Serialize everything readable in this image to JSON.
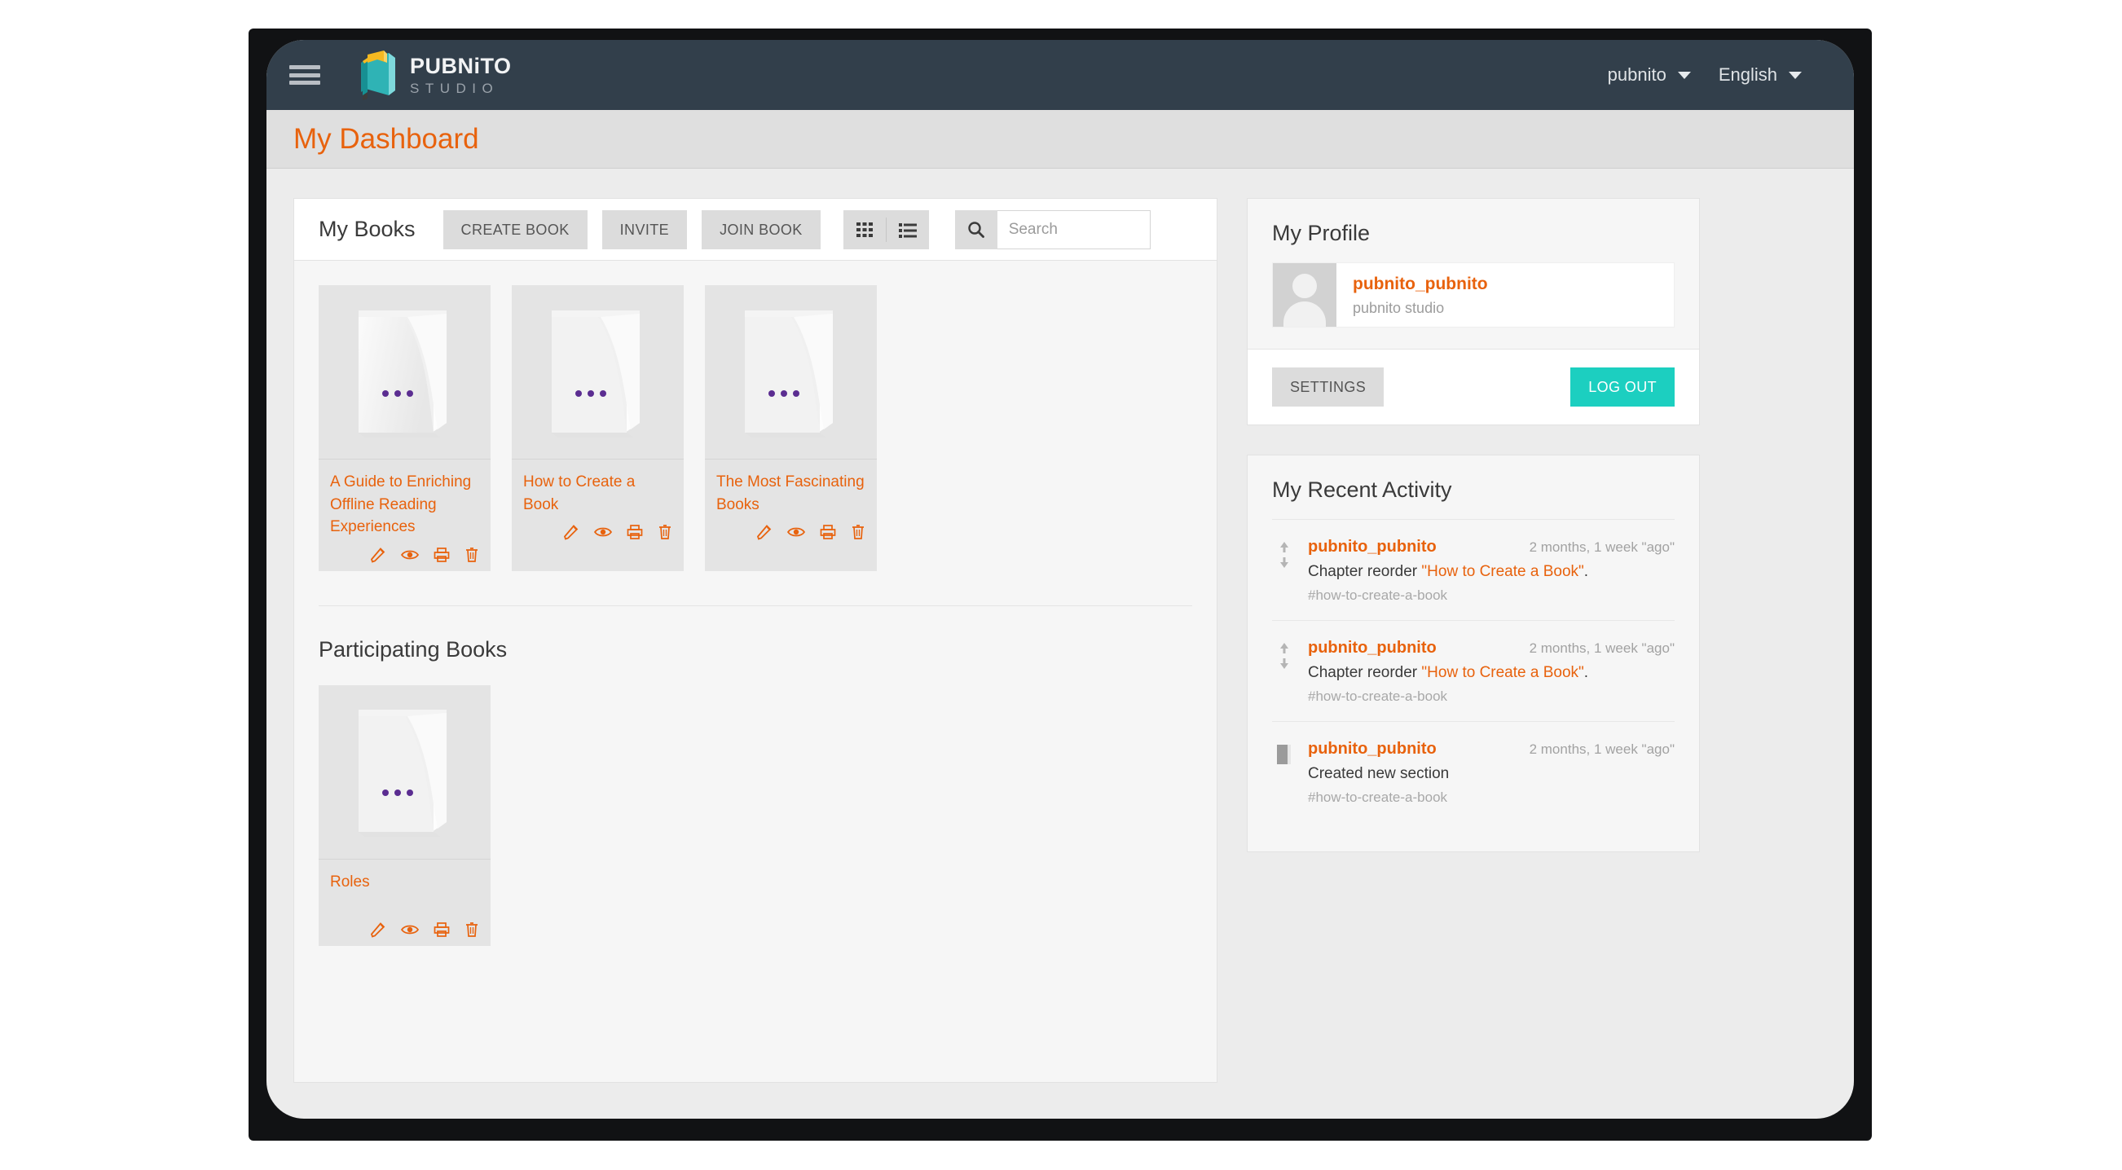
{
  "navbar": {
    "menu_icon": "hamburger-icon",
    "logo_title": "PUBNiTO",
    "logo_subtitle": "STUDIO",
    "user_menu": "pubnito",
    "language_menu": "English"
  },
  "page": {
    "title": "My Dashboard"
  },
  "books": {
    "heading": "My Books",
    "create_label": "CREATE BOOK",
    "invite_label": "INVITE",
    "join_label": "JOIN BOOK",
    "grid_view_icon": "grid-view-icon",
    "list_view_icon": "list-view-icon",
    "search_icon": "search-icon",
    "search_value": "",
    "search_placeholder": "Search",
    "items": [
      {
        "title": "A Guide to Enriching Offline Reading Experiences",
        "actions": [
          "edit-icon",
          "preview-icon",
          "print-icon",
          "delete-icon"
        ]
      },
      {
        "title": "How to Create a Book",
        "actions": [
          "edit-icon",
          "preview-icon",
          "print-icon",
          "delete-icon"
        ]
      },
      {
        "title": "The Most Fascinating Books",
        "actions": [
          "edit-icon",
          "preview-icon",
          "print-icon",
          "delete-icon"
        ]
      }
    ],
    "participating_heading": "Participating Books",
    "participating_items": [
      {
        "title": "Roles",
        "actions": [
          "edit-icon",
          "preview-icon",
          "print-icon",
          "delete-icon"
        ]
      }
    ]
  },
  "profile": {
    "heading": "My Profile",
    "username": "pubnito_pubnito",
    "organization": "pubnito studio",
    "settings_label": "SETTINGS",
    "logout_label": "LOG OUT"
  },
  "activity": {
    "heading": "My Recent Activity",
    "items": [
      {
        "icon": "reorder-arrows-icon",
        "user": "pubnito_pubnito",
        "time": "2 months, 1 week \"ago\"",
        "desc_prefix": "Chapter reorder ",
        "desc_link": "\"How to Create a Book\"",
        "desc_suffix": ".",
        "tag": "#how-to-create-a-book"
      },
      {
        "icon": "reorder-arrows-icon",
        "user": "pubnito_pubnito",
        "time": "2 months, 1 week \"ago\"",
        "desc_prefix": "Chapter reorder ",
        "desc_link": "\"How to Create a Book\"",
        "desc_suffix": ".",
        "tag": "#how-to-create-a-book"
      },
      {
        "icon": "section-book-icon",
        "user": "pubnito_pubnito",
        "time": "2 months, 1 week \"ago\"",
        "desc_prefix": "Created new section",
        "desc_link": "",
        "desc_suffix": "",
        "tag": "#how-to-create-a-book"
      }
    ]
  },
  "colors": {
    "accent_orange": "#e8620d",
    "navbar_dark": "#323f4b",
    "logout_teal": "#1ccfc0",
    "book_dots_purple": "#5b2d91"
  }
}
